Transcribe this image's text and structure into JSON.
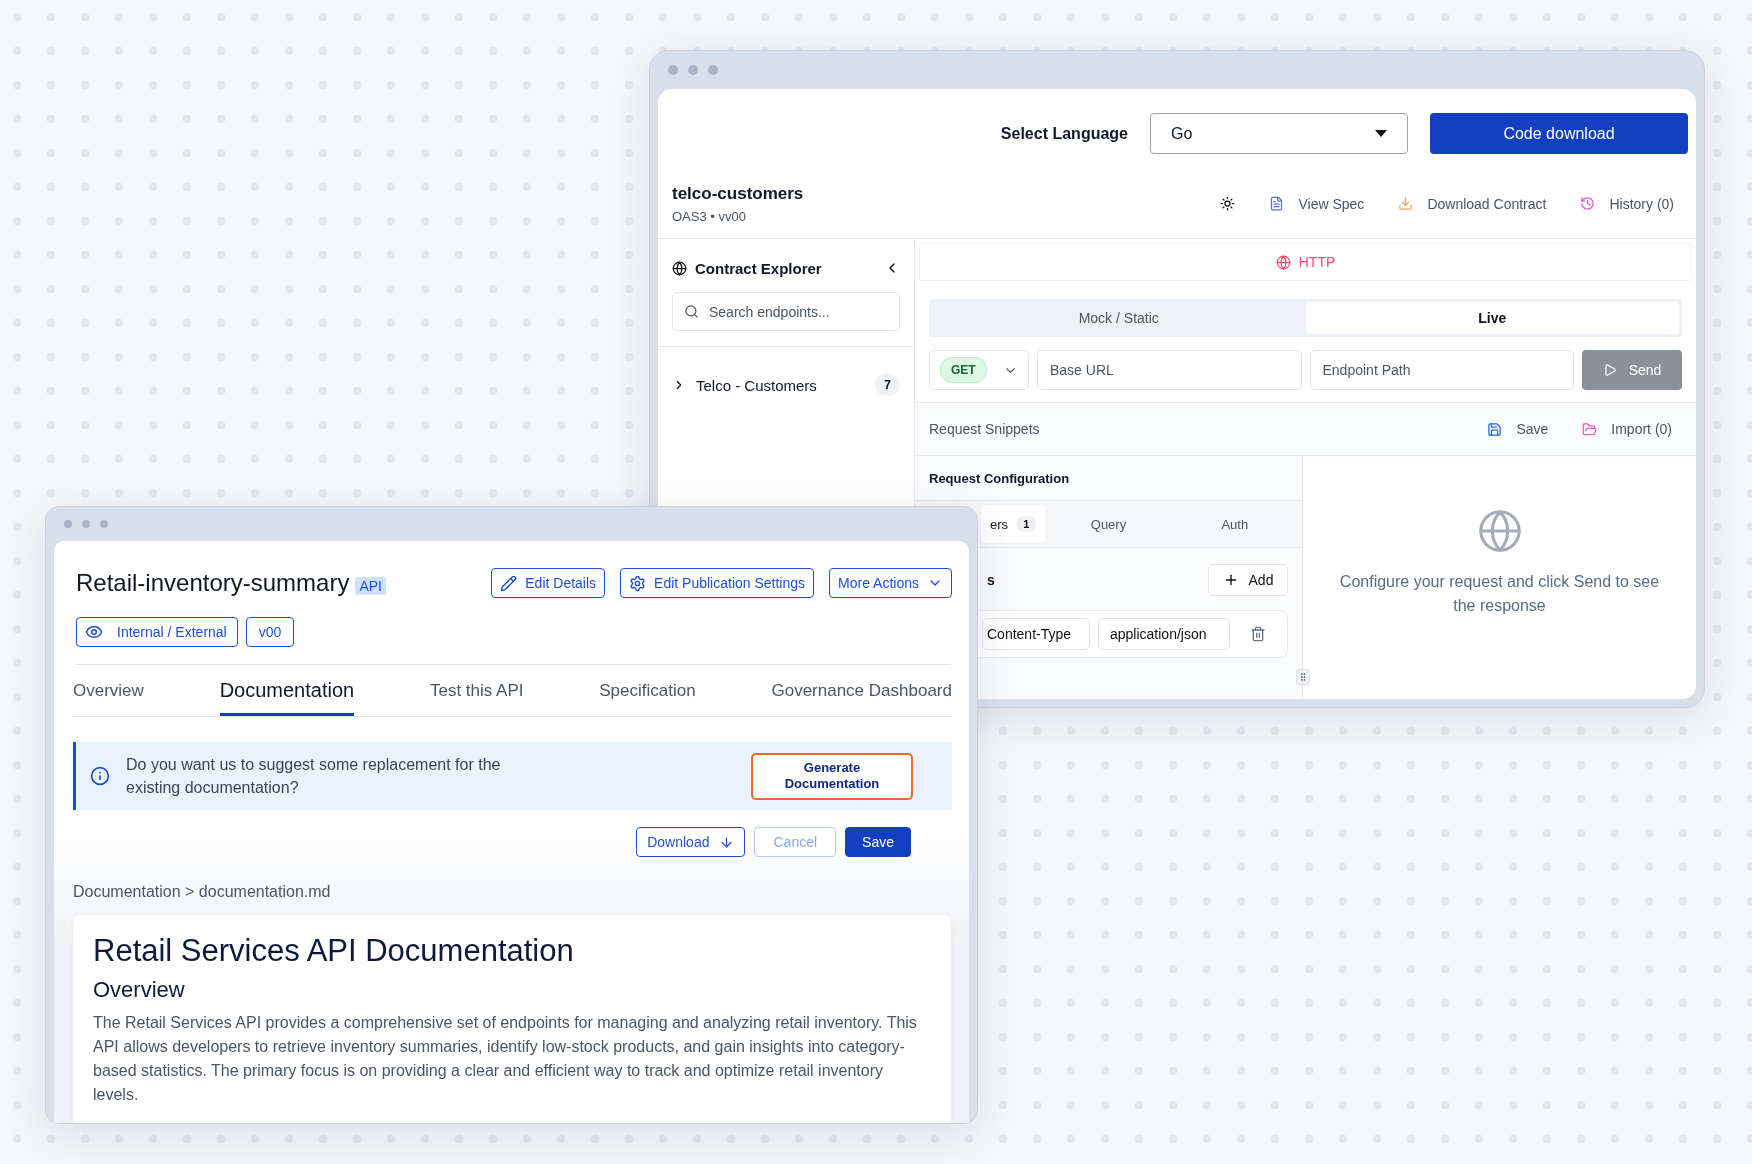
{
  "code_window": {
    "language_label": "Select Language",
    "language": "Go",
    "download_button": "Code download",
    "contract": {
      "name": "telco-customers",
      "meta": "OAS3 • vv00"
    },
    "actions": [
      {
        "kind": "theme"
      },
      {
        "kind": "spec",
        "label": "View Spec"
      },
      {
        "kind": "download",
        "label": "Download Contract"
      },
      {
        "kind": "history",
        "label": "History (0)"
      }
    ],
    "explorer": {
      "title": "Contract Explorer",
      "search": {
        "placeholder": "Search endpoints..."
      },
      "groups": [
        {
          "label": "Telco - Customers",
          "count": "7",
          "expanded": false
        }
      ]
    },
    "protocol": "HTTP",
    "modes": [
      {
        "label": "Mock / Static",
        "selected": false
      },
      {
        "label": "Live",
        "selected": true
      }
    ],
    "request": {
      "method": "GET",
      "base_url": {
        "placeholder": "Base URL"
      },
      "endpoint": {
        "placeholder": "Endpoint Path"
      },
      "send": {
        "label": "Send",
        "disabled": true
      }
    },
    "snippets": {
      "title": "Request Snippets",
      "actions": [
        {
          "kind": "save",
          "label": "Save"
        },
        {
          "kind": "import",
          "label": "Import (0)"
        }
      ]
    },
    "configuration": {
      "title": "Request Configuration",
      "tabs": [
        {
          "label": "ers",
          "count": "1",
          "selected": true
        },
        {
          "label": "Query",
          "selected": false
        },
        {
          "label": "Auth",
          "selected": false
        }
      ],
      "section_label": "s",
      "add_button": "Add",
      "headers": [
        {
          "key": "Content-Type",
          "value": "application/json"
        }
      ]
    },
    "response": {
      "message": "Configure your request and click Send to see the response"
    }
  },
  "api_window": {
    "title": "Retail-inventory-summary",
    "badge": "API",
    "actions": [
      {
        "kind": "edit",
        "label": "Edit Details"
      },
      {
        "kind": "settings",
        "label": "Edit Publication Settings"
      },
      {
        "kind": "menu",
        "label": "More Actions"
      }
    ],
    "tags": [
      {
        "kind": "visibility",
        "label": "Internal / External"
      },
      {
        "kind": "version",
        "label": "v00"
      }
    ],
    "tabs": [
      {
        "label": "Overview",
        "selected": false
      },
      {
        "label": "Documentation",
        "selected": true
      },
      {
        "label": "Test this API",
        "selected": false
      },
      {
        "label": "Specification",
        "selected": false
      },
      {
        "label": "Governance Dashboard",
        "selected": false
      }
    ],
    "banner": {
      "text": "Do you want us to suggest some replacement for the existing documentation?",
      "button": "Generate Documentation"
    },
    "editor_actions": [
      {
        "kind": "download",
        "label": "Download",
        "disabled": false
      },
      {
        "kind": "cancel",
        "label": "Cancel",
        "disabled": true
      },
      {
        "kind": "save",
        "label": "Save",
        "disabled": false
      }
    ],
    "breadcrumb": "Documentation > documentation.md",
    "document": {
      "heading": "Retail Services API Documentation",
      "subheading": "Overview",
      "paragraph": "The Retail Services API provides a comprehensive set of endpoints for managing and analyzing retail inventory. This API allows developers to retrieve inventory summaries, identify low-stock products, and gain insights into category-based statistics. The primary focus is on providing a clear and efficient way to track and optimize retail inventory levels."
    }
  }
}
